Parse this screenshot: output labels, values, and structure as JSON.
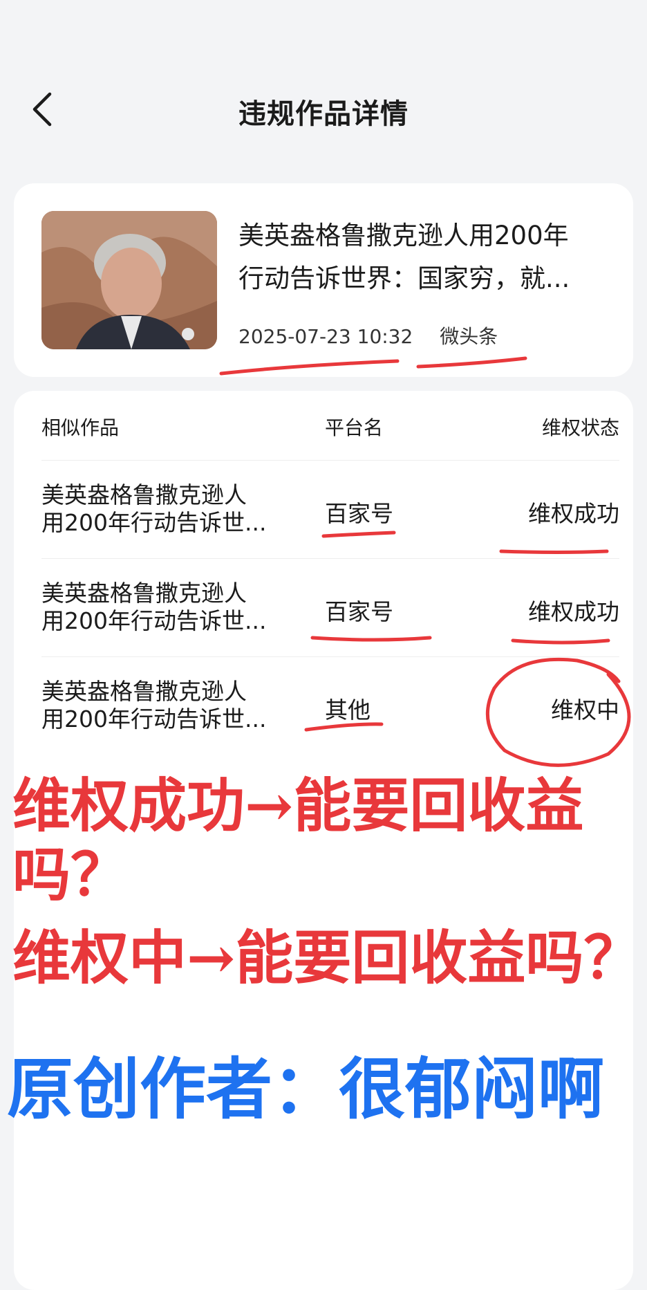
{
  "header": {
    "title": "违规作品详情"
  },
  "work": {
    "title": "美英盎格鲁撒克逊人用200年\n行动告诉世界：国家穷，就...",
    "datetime": "2025-07-23 10:32",
    "platform": "微头条"
  },
  "list": {
    "headers": {
      "work": "相似作品",
      "platform": "平台名",
      "status": "维权状态"
    },
    "rows": [
      {
        "name": "美英盎格鲁撒克逊人\n用200年行动告诉世...",
        "platform": "百家号",
        "status": "维权成功"
      },
      {
        "name": "美英盎格鲁撒克逊人\n用200年行动告诉世...",
        "platform": "百家号",
        "status": "维权成功"
      },
      {
        "name": "美英盎格鲁撒克逊人\n用200年行动告诉世...",
        "platform": "其他",
        "status": "维权中"
      }
    ]
  },
  "annotations": {
    "question_1": "维权成功→能要回收益吗？",
    "question_2": "维权中→能要回收益吗？",
    "author_line": "原创作者：很郁闷啊",
    "red_color": "#e8383b",
    "blue_color": "#1e72f0"
  }
}
